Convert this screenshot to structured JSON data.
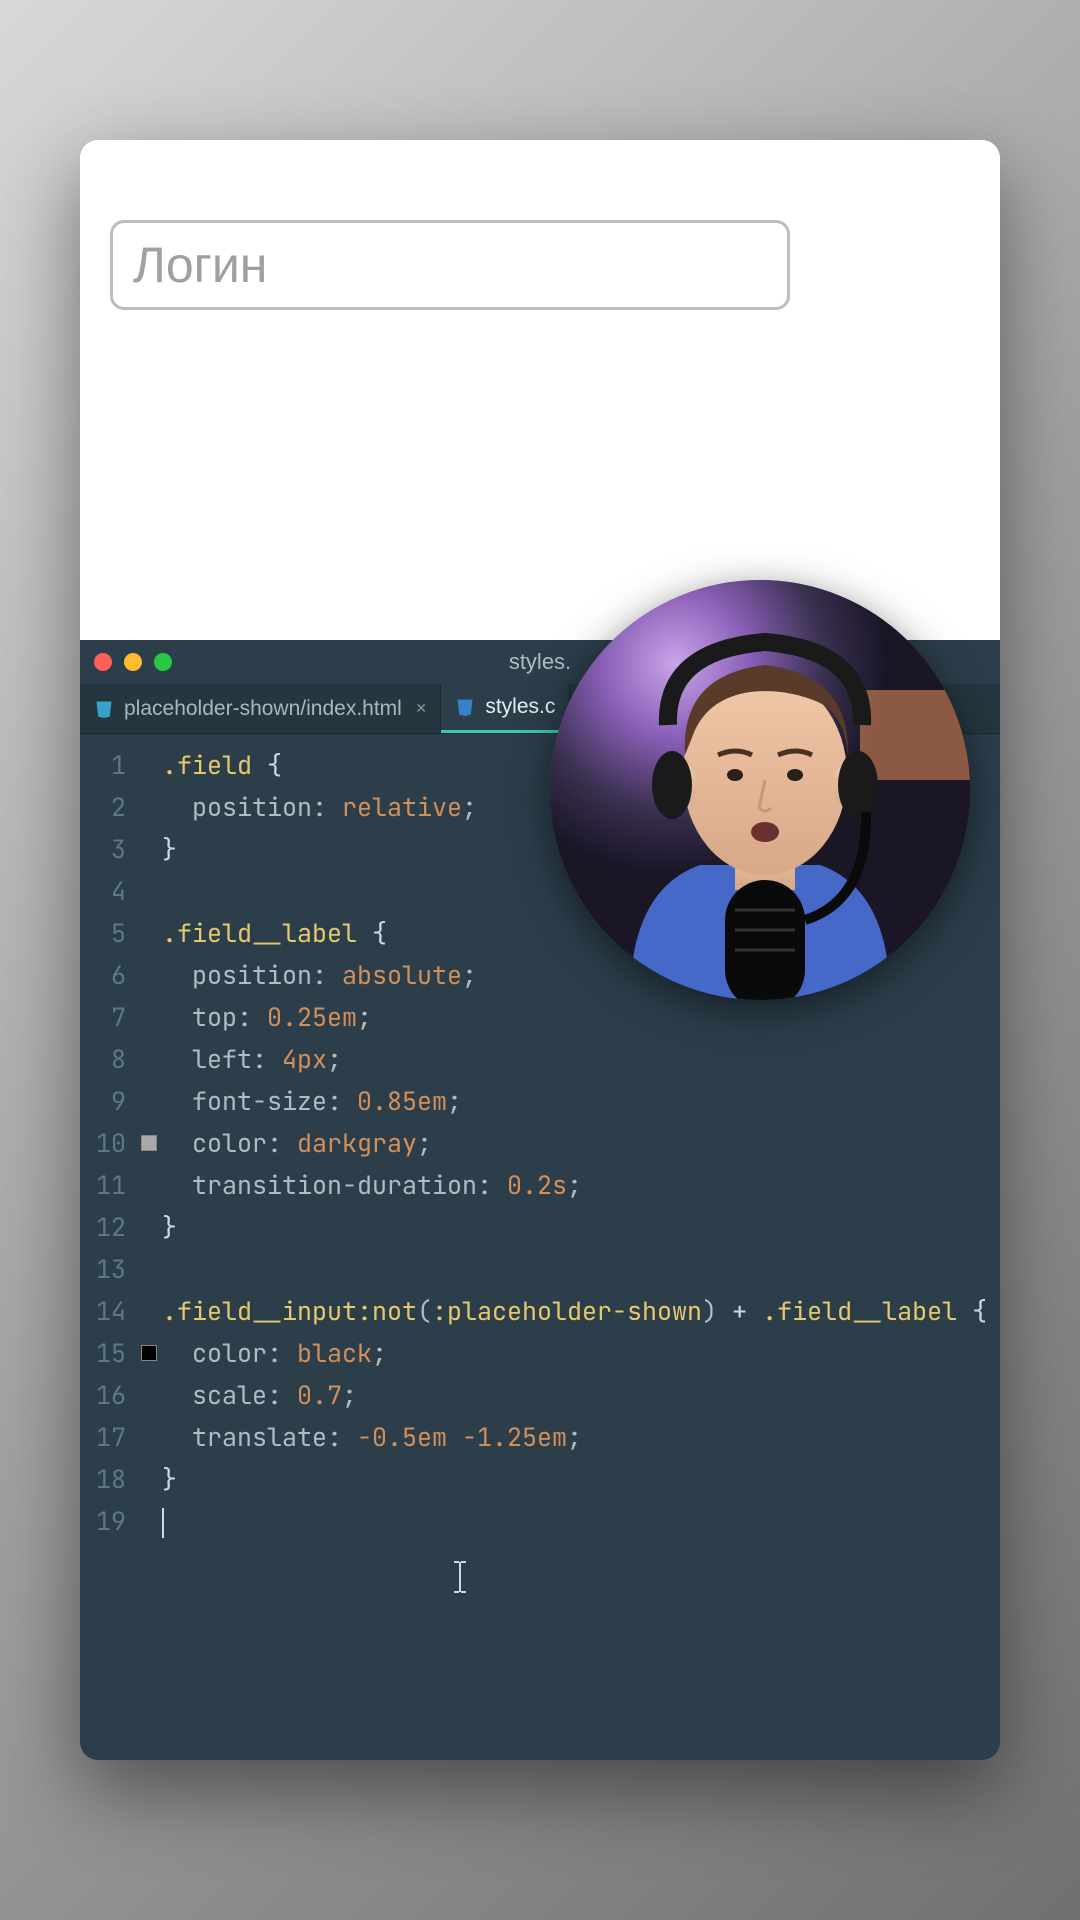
{
  "preview": {
    "login_placeholder": "Логин"
  },
  "editor": {
    "window_title": "styles.",
    "tabs": [
      {
        "label": "placeholder-shown/index.html",
        "icon": "html",
        "active": false,
        "closeable": true
      },
      {
        "label": "styles.c",
        "icon": "css",
        "active": true,
        "closeable": false
      }
    ],
    "gutter": [
      "1",
      "2",
      "3",
      "4",
      "5",
      "6",
      "7",
      "8",
      "9",
      "10",
      "11",
      "12",
      "13",
      "14",
      "15",
      "16",
      "17",
      "18",
      "19"
    ],
    "color_swatches": {
      "10": "#a9a9a9",
      "15": "#000000"
    },
    "code_lines": [
      {
        "n": 1,
        "tokens": [
          {
            "t": ".field ",
            "c": "tok-sel"
          },
          {
            "t": "{",
            "c": "tok-brace"
          }
        ]
      },
      {
        "n": 2,
        "tokens": [
          {
            "t": "  position",
            "c": "tok-prop"
          },
          {
            "t": ": ",
            "c": "tok-punc"
          },
          {
            "t": "relative",
            "c": "tok-val"
          },
          {
            "t": ";",
            "c": "tok-punc"
          }
        ]
      },
      {
        "n": 3,
        "tokens": [
          {
            "t": "}",
            "c": "tok-brace"
          }
        ]
      },
      {
        "n": 4,
        "tokens": [
          {
            "t": "",
            "c": ""
          }
        ]
      },
      {
        "n": 5,
        "tokens": [
          {
            "t": ".field__label ",
            "c": "tok-sel"
          },
          {
            "t": "{",
            "c": "tok-brace"
          }
        ]
      },
      {
        "n": 6,
        "tokens": [
          {
            "t": "  position",
            "c": "tok-prop"
          },
          {
            "t": ": ",
            "c": "tok-punc"
          },
          {
            "t": "absolute",
            "c": "tok-val"
          },
          {
            "t": ";",
            "c": "tok-punc"
          }
        ]
      },
      {
        "n": 7,
        "tokens": [
          {
            "t": "  top",
            "c": "tok-prop"
          },
          {
            "t": ": ",
            "c": "tok-punc"
          },
          {
            "t": "0.25em",
            "c": "tok-val"
          },
          {
            "t": ";",
            "c": "tok-punc"
          }
        ]
      },
      {
        "n": 8,
        "tokens": [
          {
            "t": "  left",
            "c": "tok-prop"
          },
          {
            "t": ": ",
            "c": "tok-punc"
          },
          {
            "t": "4px",
            "c": "tok-val"
          },
          {
            "t": ";",
            "c": "tok-punc"
          }
        ]
      },
      {
        "n": 9,
        "tokens": [
          {
            "t": "  font-size",
            "c": "tok-prop"
          },
          {
            "t": ": ",
            "c": "tok-punc"
          },
          {
            "t": "0.85em",
            "c": "tok-val"
          },
          {
            "t": ";",
            "c": "tok-punc"
          }
        ]
      },
      {
        "n": 10,
        "tokens": [
          {
            "t": "  color",
            "c": "tok-prop"
          },
          {
            "t": ": ",
            "c": "tok-punc"
          },
          {
            "t": "darkgray",
            "c": "tok-val"
          },
          {
            "t": ";",
            "c": "tok-punc"
          }
        ]
      },
      {
        "n": 11,
        "tokens": [
          {
            "t": "  transition-duration",
            "c": "tok-prop"
          },
          {
            "t": ": ",
            "c": "tok-punc"
          },
          {
            "t": "0.2s",
            "c": "tok-val"
          },
          {
            "t": ";",
            "c": "tok-punc"
          }
        ]
      },
      {
        "n": 12,
        "tokens": [
          {
            "t": "}",
            "c": "tok-brace"
          }
        ]
      },
      {
        "n": 13,
        "tokens": [
          {
            "t": "",
            "c": ""
          }
        ]
      },
      {
        "n": 14,
        "tokens": [
          {
            "t": ".field__input",
            "c": "tok-sel"
          },
          {
            "t": ":not",
            "c": "tok-pseudo"
          },
          {
            "t": "(",
            "c": "tok-punc"
          },
          {
            "t": ":placeholder-shown",
            "c": "tok-pseudo"
          },
          {
            "t": ") ",
            "c": "tok-punc"
          },
          {
            "t": "+ ",
            "c": "tok-plus"
          },
          {
            "t": ".field__label ",
            "c": "tok-sel"
          },
          {
            "t": "{",
            "c": "tok-brace"
          }
        ]
      },
      {
        "n": 15,
        "tokens": [
          {
            "t": "  color",
            "c": "tok-prop"
          },
          {
            "t": ": ",
            "c": "tok-punc"
          },
          {
            "t": "black",
            "c": "tok-val"
          },
          {
            "t": ";",
            "c": "tok-punc"
          }
        ]
      },
      {
        "n": 16,
        "tokens": [
          {
            "t": "  scale",
            "c": "tok-prop"
          },
          {
            "t": ": ",
            "c": "tok-punc"
          },
          {
            "t": "0.7",
            "c": "tok-val"
          },
          {
            "t": ";",
            "c": "tok-punc"
          }
        ]
      },
      {
        "n": 17,
        "tokens": [
          {
            "t": "  translate",
            "c": "tok-prop"
          },
          {
            "t": ": ",
            "c": "tok-punc"
          },
          {
            "t": "-0.5em -1.25em",
            "c": "tok-val"
          },
          {
            "t": ";",
            "c": "tok-punc"
          }
        ]
      },
      {
        "n": 18,
        "tokens": [
          {
            "t": "}",
            "c": "tok-brace"
          }
        ]
      },
      {
        "n": 19,
        "tokens": [
          {
            "t": "",
            "c": ""
          }
        ]
      }
    ]
  }
}
